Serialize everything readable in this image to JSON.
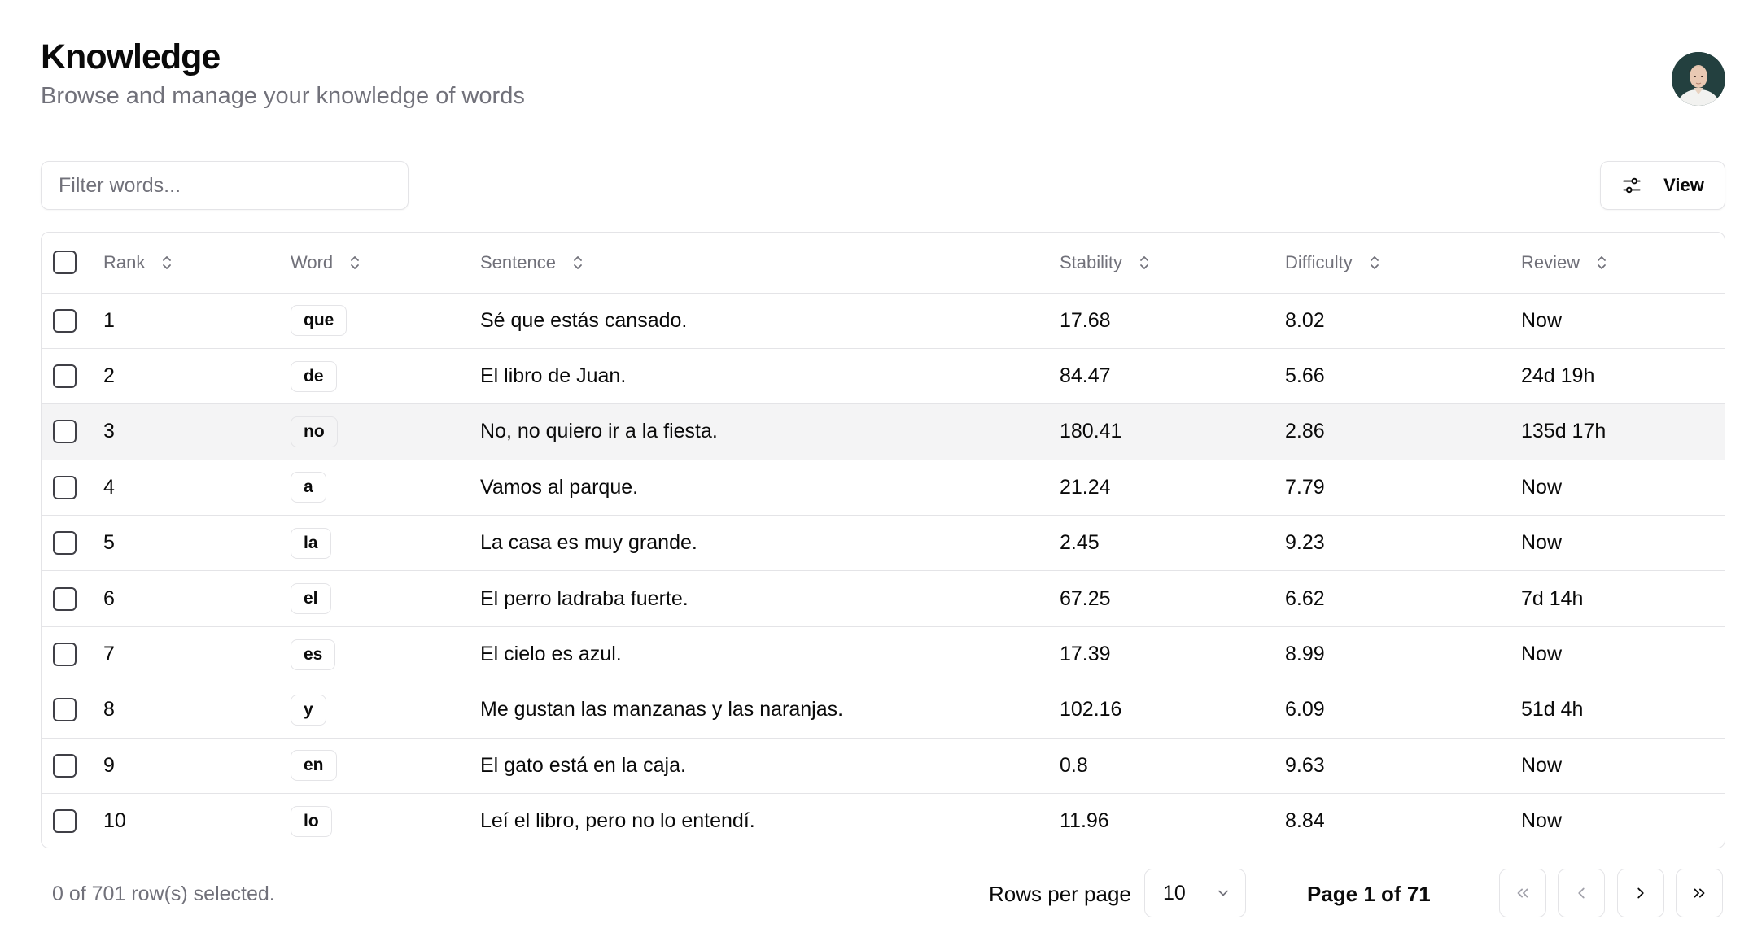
{
  "header": {
    "title": "Knowledge",
    "subtitle": "Browse and manage your knowledge of words"
  },
  "toolbar": {
    "filter_placeholder": "Filter words...",
    "filter_value": "",
    "view_label": "View"
  },
  "table": {
    "columns": {
      "rank": "Rank",
      "word": "Word",
      "sentence": "Sentence",
      "stability": "Stability",
      "difficulty": "Difficulty",
      "review": "Review"
    },
    "rows": [
      {
        "rank": "1",
        "word": "que",
        "sentence": "Sé que estás cansado.",
        "stability": "17.68",
        "difficulty": "8.02",
        "review": "Now"
      },
      {
        "rank": "2",
        "word": "de",
        "sentence": "El libro de Juan.",
        "stability": "84.47",
        "difficulty": "5.66",
        "review": "24d 19h"
      },
      {
        "rank": "3",
        "word": "no",
        "sentence": "No, no quiero ir a la fiesta.",
        "stability": "180.41",
        "difficulty": "2.86",
        "review": "135d 17h"
      },
      {
        "rank": "4",
        "word": "a",
        "sentence": "Vamos al parque.",
        "stability": "21.24",
        "difficulty": "7.79",
        "review": "Now"
      },
      {
        "rank": "5",
        "word": "la",
        "sentence": "La casa es muy grande.",
        "stability": "2.45",
        "difficulty": "9.23",
        "review": "Now"
      },
      {
        "rank": "6",
        "word": "el",
        "sentence": "El perro ladraba fuerte.",
        "stability": "67.25",
        "difficulty": "6.62",
        "review": "7d 14h"
      },
      {
        "rank": "7",
        "word": "es",
        "sentence": "El cielo es azul.",
        "stability": "17.39",
        "difficulty": "8.99",
        "review": "Now"
      },
      {
        "rank": "8",
        "word": "y",
        "sentence": "Me gustan las manzanas y las naranjas.",
        "stability": "102.16",
        "difficulty": "6.09",
        "review": "51d 4h"
      },
      {
        "rank": "9",
        "word": "en",
        "sentence": "El gato está en la caja.",
        "stability": "0.8",
        "difficulty": "9.63",
        "review": "Now"
      },
      {
        "rank": "10",
        "word": "lo",
        "sentence": "Leí el libro, pero no lo entendí.",
        "stability": "11.96",
        "difficulty": "8.84",
        "review": "Now"
      }
    ]
  },
  "footer": {
    "selected_text": "0 of 701 row(s) selected.",
    "rows_per_page_label": "Rows per page",
    "rows_per_page_value": "10",
    "page_text": "Page 1 of 71"
  },
  "icons": {
    "view": "sliders-icon",
    "sort": "chevrons-up-down-icon",
    "select": "chevron-down-icon",
    "first": "chevrons-left-icon",
    "prev": "chevron-left-icon",
    "next": "chevron-right-icon",
    "last": "chevrons-right-icon"
  },
  "colors": {
    "border": "#e4e4e7",
    "muted_text": "#71717a",
    "row_highlight": "#f4f4f5"
  }
}
